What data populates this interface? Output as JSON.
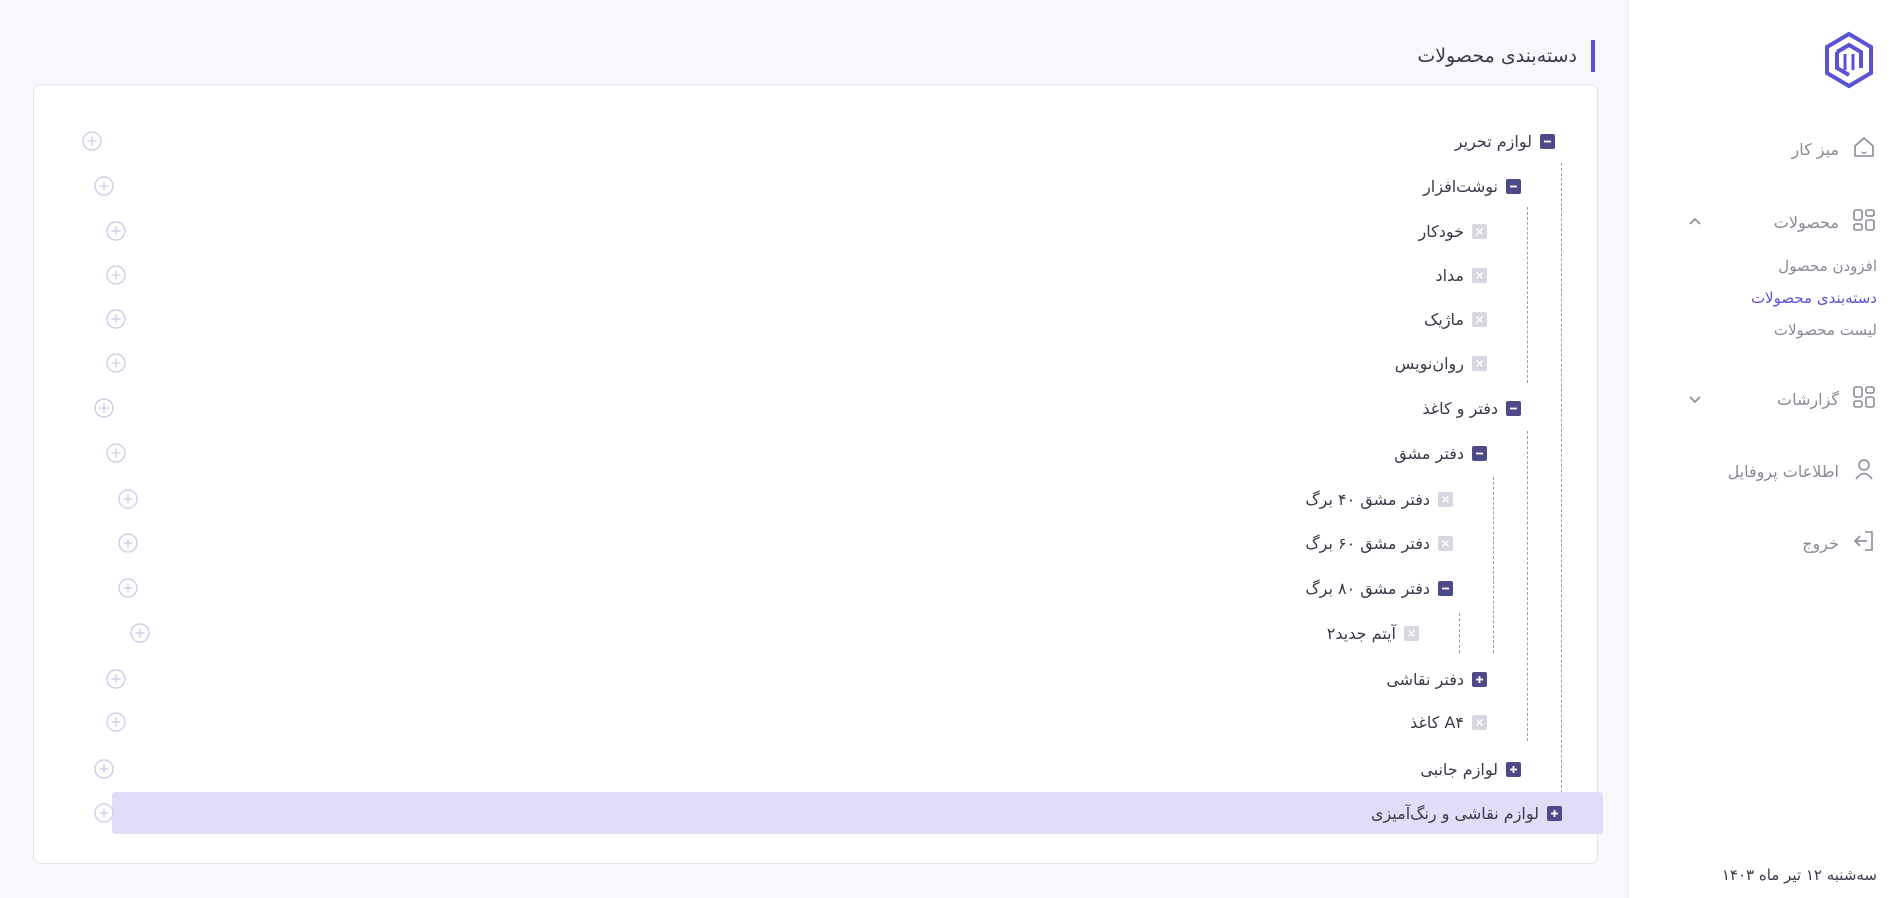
{
  "page": {
    "title": "دسته‌بندی محصولات"
  },
  "sidebar": {
    "logo_icon": "logo-hexagon",
    "items": [
      {
        "label": "میز کار",
        "icon": "home-icon"
      },
      {
        "label": "محصولات",
        "icon": "grid-icon",
        "expanded": true,
        "children": [
          {
            "label": "افزودن محصول"
          },
          {
            "label": "دسته‌بندی محصولات",
            "active": true
          },
          {
            "label": "لیست محصولات"
          }
        ]
      },
      {
        "label": "گزارشات",
        "icon": "grid-icon",
        "expanded": false
      },
      {
        "label": "اطلاعات پروفایل",
        "icon": "user-icon"
      },
      {
        "label": "خروج",
        "icon": "logout-icon"
      }
    ],
    "date": "سه‌شنبه ۱۲ تیر ماه ۱۴۰۳"
  },
  "tree": {
    "nodes": [
      {
        "label": "لوازم تحریر",
        "depth": 0,
        "state": "expanded"
      },
      {
        "label": "نوشت‌افزار",
        "depth": 1,
        "state": "expanded"
      },
      {
        "label": "خودکار",
        "depth": 2,
        "state": "leaf"
      },
      {
        "label": "مداد",
        "depth": 2,
        "state": "leaf"
      },
      {
        "label": "ماژیک",
        "depth": 2,
        "state": "leaf"
      },
      {
        "label": "روان‌نویس",
        "depth": 2,
        "state": "leaf"
      },
      {
        "label": "دفتر و کاغذ",
        "depth": 1,
        "state": "expanded"
      },
      {
        "label": "دفتر مشق",
        "depth": 2,
        "state": "expanded"
      },
      {
        "label": "دفتر مشق ۴۰ برگ",
        "depth": 3,
        "state": "leaf"
      },
      {
        "label": "دفتر مشق ۶۰ برگ",
        "depth": 3,
        "state": "leaf"
      },
      {
        "label": "دفتر مشق ۸۰ برگ",
        "depth": 3,
        "state": "expanded"
      },
      {
        "label": "آیتم جدید۲",
        "depth": 4,
        "state": "leaf"
      },
      {
        "label": "دفتر نقاشی",
        "depth": 2,
        "state": "collapsed"
      },
      {
        "label": "کاغذ A۴",
        "depth": 2,
        "state": "leaf"
      },
      {
        "label": "لوازم جانبی",
        "depth": 1,
        "state": "collapsed"
      },
      {
        "label": "لوازم نقاشی و رنگ‌آمیزی",
        "depth": 1,
        "state": "collapsed",
        "selected": true
      }
    ]
  },
  "colors": {
    "accent": "#5b53d6",
    "node_box": "#4d4a8a",
    "leaf_box": "#d7d7df",
    "selected_row": "#e1ddf7",
    "add_icon": "#cfcdea"
  }
}
